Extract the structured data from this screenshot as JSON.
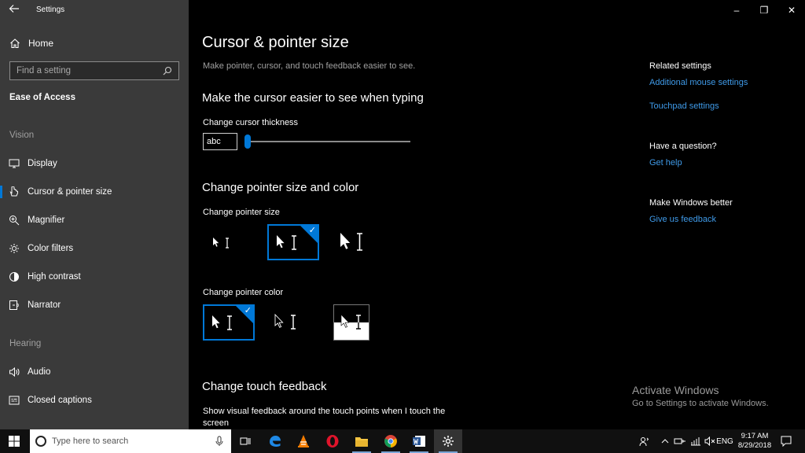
{
  "window": {
    "app_title": "Settings",
    "controls": {
      "minimize": "–",
      "restore": "❐",
      "close": "✕"
    }
  },
  "sidebar": {
    "back_icon": "back-arrow-icon",
    "home_label": "Home",
    "search_placeholder": "Find a setting",
    "section": "Ease of Access",
    "groups": {
      "vision": "Vision",
      "hearing": "Hearing"
    },
    "items": [
      {
        "label": "Display",
        "icon": "display-icon"
      },
      {
        "label": "Cursor & pointer size",
        "icon": "cursor-icon",
        "active": true
      },
      {
        "label": "Magnifier",
        "icon": "magnifier-icon"
      },
      {
        "label": "Color filters",
        "icon": "color-filters-icon"
      },
      {
        "label": "High contrast",
        "icon": "high-contrast-icon"
      },
      {
        "label": "Narrator",
        "icon": "narrator-icon"
      },
      {
        "label": "Audio",
        "icon": "audio-icon"
      },
      {
        "label": "Closed captions",
        "icon": "closed-captions-icon"
      }
    ]
  },
  "main": {
    "title": "Cursor & pointer size",
    "description": "Make pointer, cursor, and touch feedback easier to see.",
    "cursor_section": "Make the cursor easier to see when typing",
    "thickness_label": "Change cursor thickness",
    "thickness_preview": "abc",
    "thickness_value": 1,
    "pointer_section": "Change pointer size and color",
    "size_label": "Change pointer size",
    "size_selected": 2,
    "color_label": "Change pointer color",
    "color_selected": 1,
    "touch_section": "Change touch feedback",
    "touch_text": "Show visual feedback around the touch points when I touch the screen"
  },
  "related": {
    "heading": "Related settings",
    "links": [
      "Additional mouse settings",
      "Touchpad settings"
    ],
    "question_heading": "Have a question?",
    "question_link": "Get help",
    "better_heading": "Make Windows better",
    "better_link": "Give us feedback"
  },
  "watermark": {
    "line1": "Activate Windows",
    "line2": "Go to Settings to activate Windows."
  },
  "taskbar": {
    "search_placeholder": "Type here to search",
    "language": "ENG",
    "time": "9:17 AM",
    "date": "8/29/2018",
    "apps": [
      "task-view-icon",
      "edge-icon",
      "vlc-icon",
      "opera-icon",
      "file-explorer-icon",
      "chrome-icon",
      "word-icon",
      "settings-icon"
    ]
  },
  "colors": {
    "accent": "#0078d7",
    "link": "#3f9ae8",
    "sidebar_bg": "#3a3a3a",
    "main_bg": "#000000"
  }
}
